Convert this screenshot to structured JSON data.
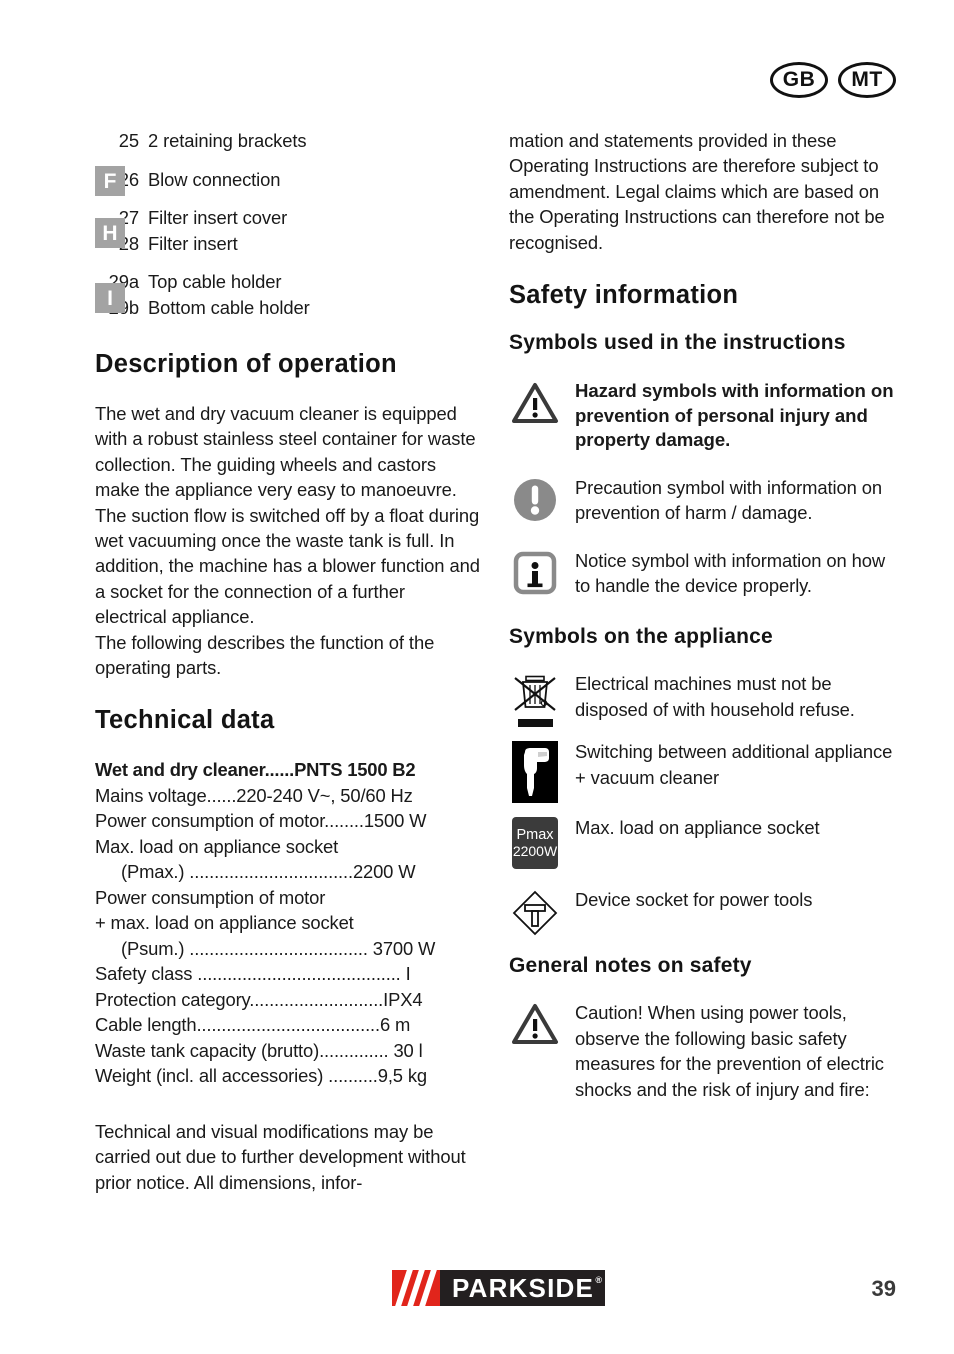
{
  "header": {
    "badges": [
      "GB",
      "MT"
    ]
  },
  "left_column": {
    "parts": [
      {
        "chip": "",
        "num": "25",
        "label": "2 retaining brackets"
      },
      {
        "chip": "F",
        "num": "26",
        "label": "Blow connection"
      },
      {
        "chip": "H",
        "num": "27",
        "label": "Filter insert cover"
      },
      {
        "chip": "",
        "num": "28",
        "label": "Filter insert"
      },
      {
        "chip": "I",
        "num": "29a",
        "label": "Top cable holder"
      },
      {
        "chip": "",
        "num": "29b",
        "label": "Bottom cable holder"
      }
    ],
    "chips": {
      "f": "F",
      "h": "H",
      "i": "I"
    },
    "description_heading": "Description of operation",
    "description_p1": "The wet and dry vacuum cleaner is equipped with a robust stainless steel container for waste collection. The guiding wheels and castors make the appliance very easy to manoeuvre. The suction flow is switched off by a float during wet vacuuming once the waste tank is full. In addition, the machine has a blower function and a socket for the connection of a further electrical appliance.",
    "description_p2": "The following describes the function of the operating parts.",
    "technical_heading": "Technical data",
    "technical_lines": [
      "Wet and dry cleaner......PNTS 1500 B2",
      "Mains voltage......220-240 V~, 50/60 Hz",
      "Power consumption of motor........1500 W",
      "Max. load on appliance socket",
      "(Pmax.) .................................2200 W",
      "Power consumption of motor",
      "+ max. load on appliance socket",
      "(Psum.) .................................... 3700 W",
      "Safety class ......................................... I",
      "Protection category...........................IPX4",
      "Cable length.....................................6 m",
      "Waste tank capacity (brutto).............. 30 l",
      "Weight (incl. all accessories) ..........9,5 kg"
    ],
    "closing_note": "Technical and visual modifications may be carried out due to further development without prior notice. All dimensions, infor-"
  },
  "right_column": {
    "continued_paragraph": "mation and statements provided in these Operating Instructions are therefore subject to amendment. Legal claims which are based on the Operating Instructions can therefore not be recognised.",
    "safety_heading": "Safety information",
    "symbols_instructions_heading": "Symbols used in the instructions",
    "instruction_symbols": [
      {
        "icon": "warning-triangle-icon",
        "bold": true,
        "text": "Hazard symbols with information on prevention of personal injury and property damage."
      },
      {
        "icon": "precaution-circle-icon",
        "bold": false,
        "text": "Precaution symbol with information on prevention of harm / damage."
      },
      {
        "icon": "notice-info-icon",
        "bold": false,
        "text": "Notice symbol with information on how to handle the device properly."
      }
    ],
    "symbols_appliance_heading": "Symbols on the appliance",
    "appliance_symbols": [
      {
        "icon": "crossed-bin-icon",
        "text": "Electrical machines must not be disposed of with household refuse."
      },
      {
        "icon": "power-drill-icon",
        "text": "Switching between additional appliance + vacuum cleaner"
      },
      {
        "icon": "pmax-chip-icon",
        "text": "Max. load on appliance socket"
      },
      {
        "icon": "device-socket-icon",
        "text": "Device socket for power tools"
      }
    ],
    "pmax_chip": {
      "line1": "Pmax",
      "line2": "2200W"
    },
    "general_notes_heading": "General notes on safety",
    "general_notes_text": "Caution! When using power tools, observe the following basic safety measures for the prevention of electric shocks and the risk of injury and fire:"
  },
  "footer": {
    "brand": "PARKSIDE",
    "brand_mark": "®",
    "page_number": "39"
  },
  "colors": {
    "chip_gray": "#a3a3a3",
    "dark_chip": "#3b3b3b",
    "brand_red": "#e1251b",
    "brand_black": "#231f20"
  }
}
